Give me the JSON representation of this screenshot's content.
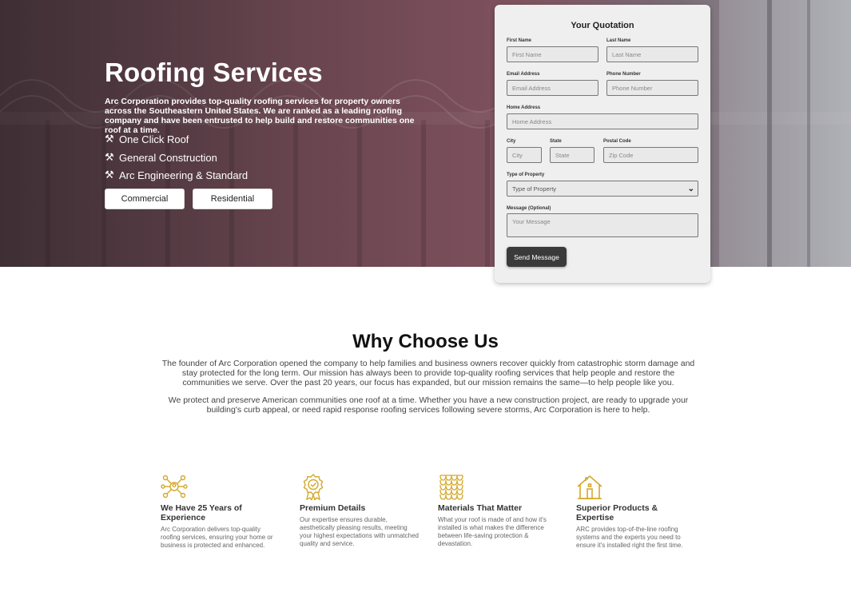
{
  "hero": {
    "title": "Roofing Services",
    "description": "Arc Corporation provides top-quality roofing services for property owners across the Southeastern United States. We are ranked as a leading roofing company and have been entrusted to help build and restore communities one roof at a time.",
    "features": [
      "One Click Roof",
      "General Construction",
      "Arc Engineering & Standard"
    ],
    "feature_icon": "tools-icon",
    "buttons": {
      "commercial": "Commercial",
      "residential": "Residential"
    }
  },
  "form": {
    "title": "Your Quotation",
    "first_name": {
      "label": "First Name",
      "placeholder": "First Name"
    },
    "last_name": {
      "label": "Last Name",
      "placeholder": "Last Name"
    },
    "email": {
      "label": "Email Address",
      "placeholder": "Email Address"
    },
    "phone": {
      "label": "Phone Number",
      "placeholder": "Phone Number"
    },
    "home_address": {
      "label": "Home Address",
      "placeholder": "Home Address"
    },
    "city": {
      "label": "City",
      "placeholder": "City"
    },
    "state": {
      "label": "State",
      "placeholder": "State"
    },
    "postal_code": {
      "label": "Postal Code",
      "placeholder": "Zip Code"
    },
    "property_type": {
      "label": "Type of Property",
      "selected": "Type of Property"
    },
    "message": {
      "label": "Message (Optional)",
      "placeholder": "Your Message"
    },
    "submit": "Send Message"
  },
  "why": {
    "title": "Why Choose Us",
    "paragraph1": "The founder of Arc Corporation opened the company to help families and business owners recover quickly from catastrophic storm damage and stay protected for the long term. Our mission has always been to provide top-quality roofing services that help people and restore the communities we serve. Over the past 20 years, our focus has expanded, but our mission remains the same—to help people like you.",
    "paragraph2": "We protect and preserve American communities one roof at a time. Whether you have a new construction project, are ready to upgrade your building's curb appeal, or need rapid response roofing services following severe storms, Arc Corporation is here to help."
  },
  "features": [
    {
      "icon": "network-people-icon",
      "title": "We Have 25 Years of Experience",
      "desc": "Arc Corporation delivers top-quality roofing services, ensuring your home or business is protected and enhanced."
    },
    {
      "icon": "award-ribbon-icon",
      "title": "Premium Details",
      "desc": "Our expertise ensures durable, aesthetically pleasing results, meeting your highest expectations with unmatched quality and service."
    },
    {
      "icon": "roof-tiles-icon",
      "title": "Materials That Matter",
      "desc": "What your roof is made of and how it's installed is what makes the difference between life-saving protection & devastation."
    },
    {
      "icon": "house-icon",
      "title": "Superior Products & Expertise",
      "desc": "ARC provides top-of-the-line roofing systems and the experts you need to ensure it's installed right the first time."
    }
  ],
  "colors": {
    "accent_gold": "#d4a82a",
    "button_dark": "#3a3a3a"
  }
}
